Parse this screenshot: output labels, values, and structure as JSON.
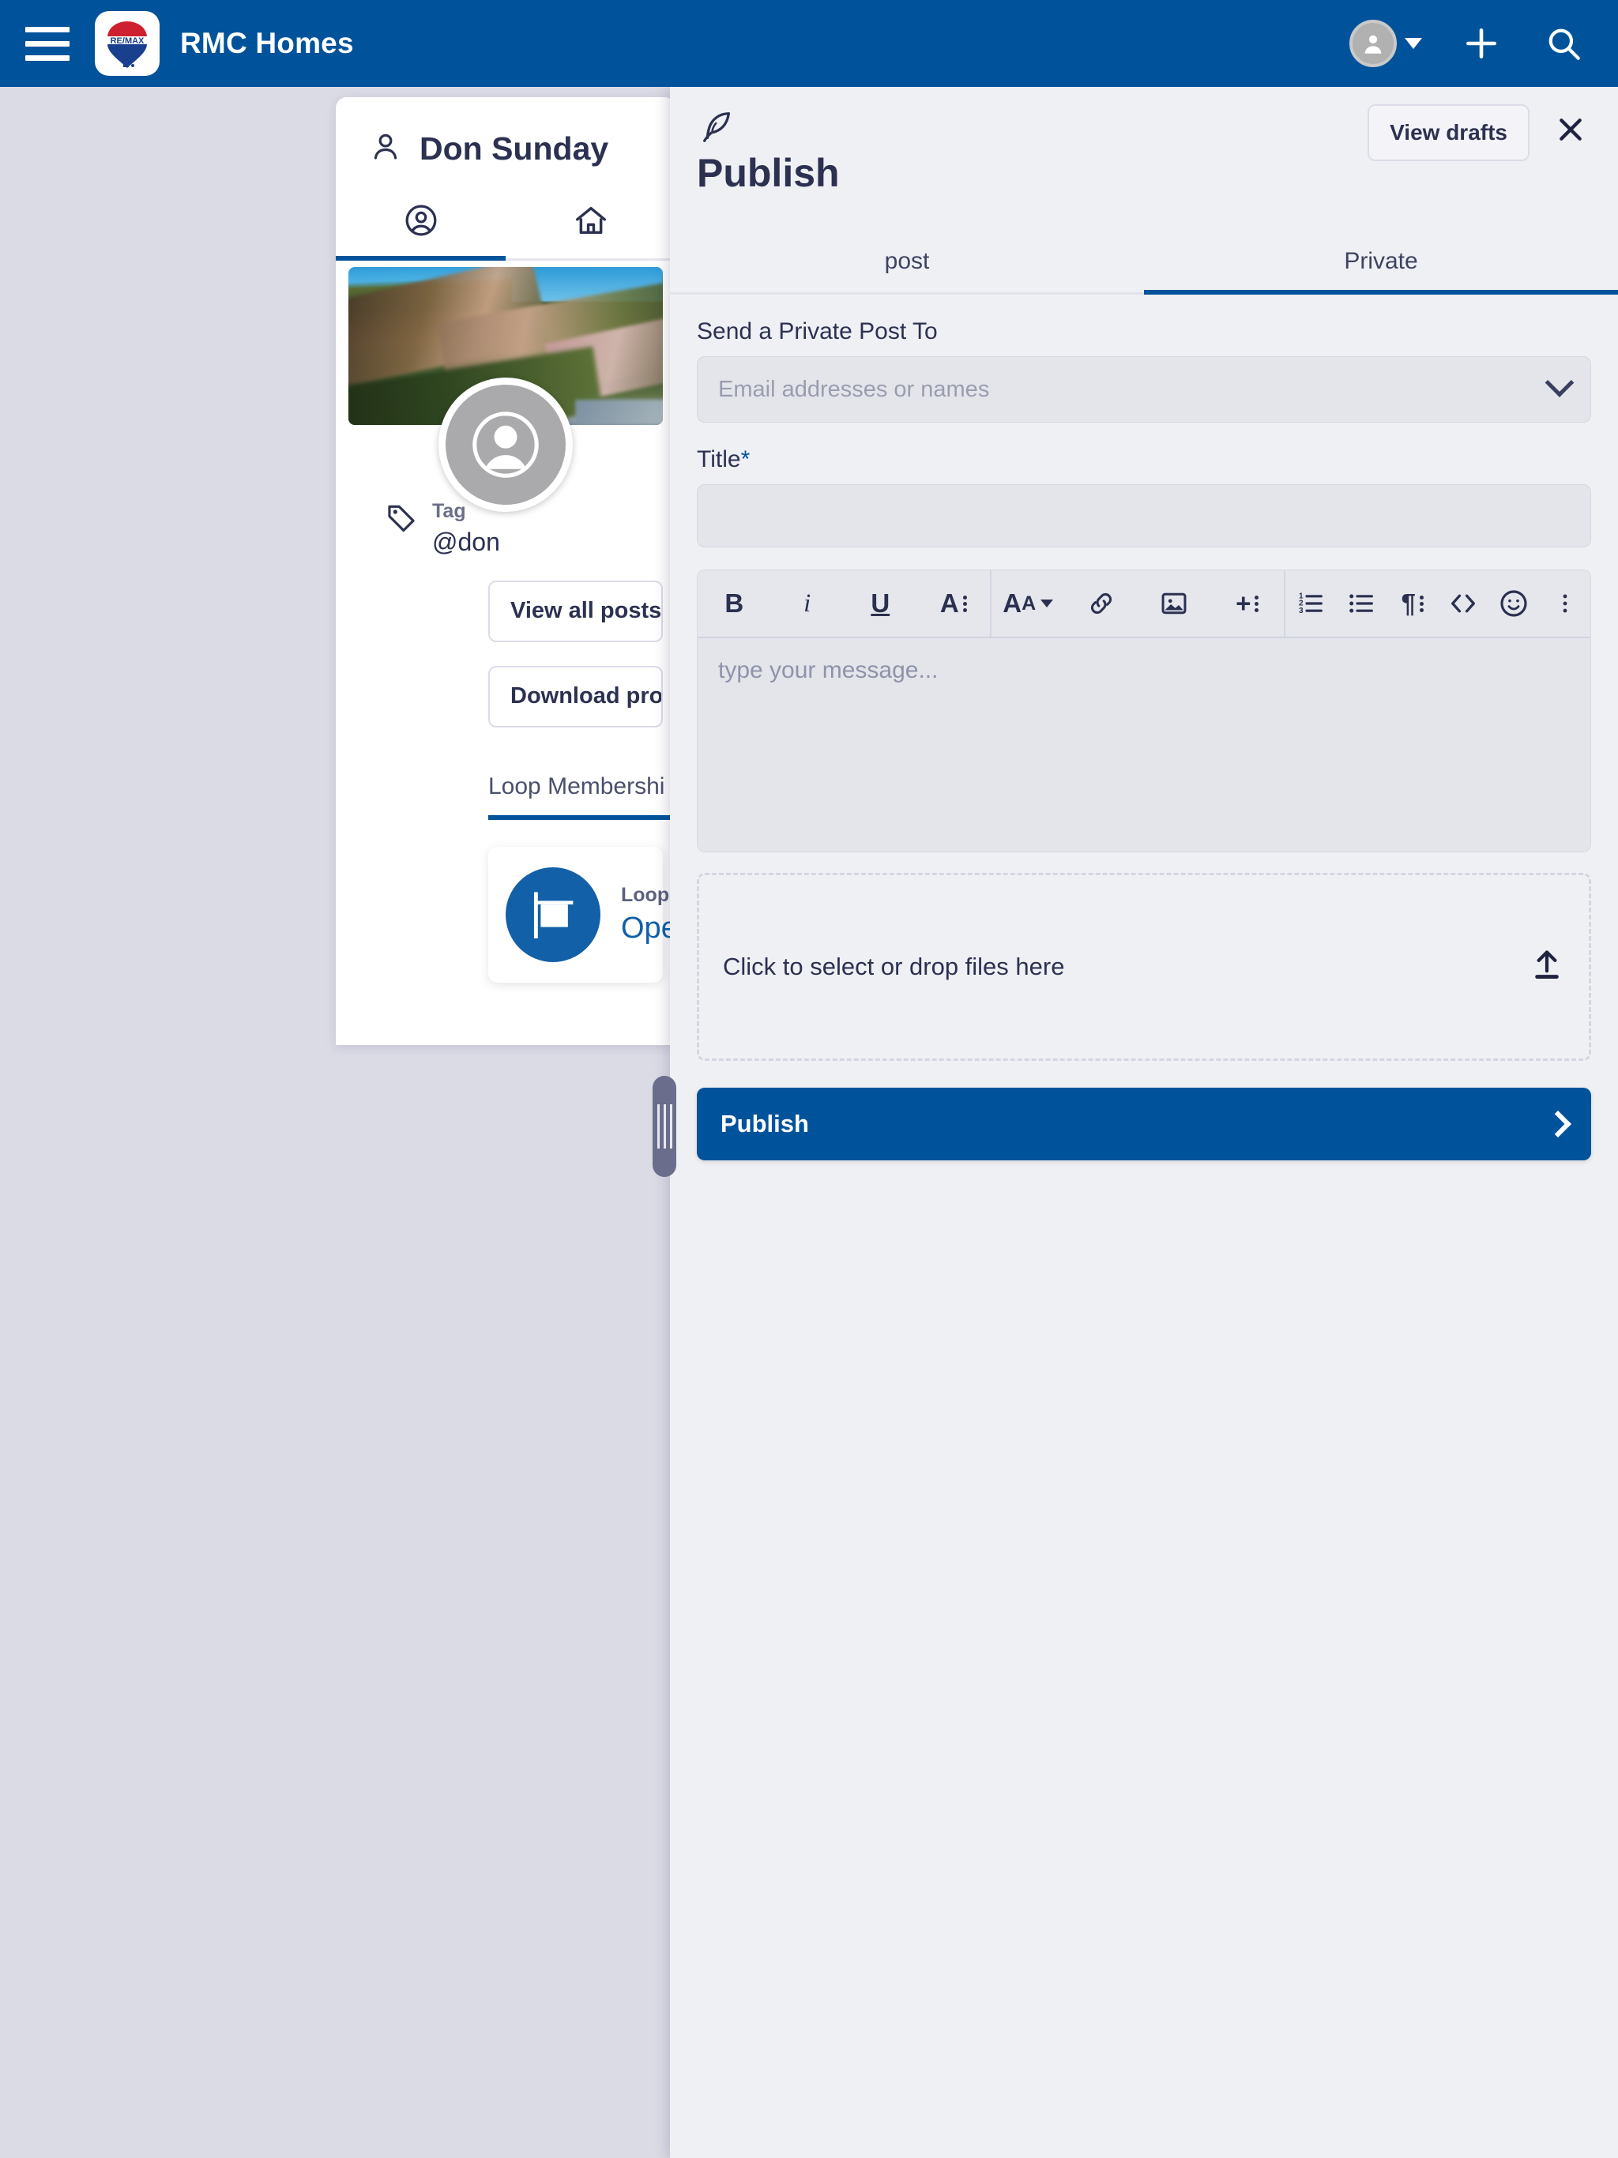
{
  "appbar": {
    "menu_icon": "hamburger-menu-icon",
    "logo_icon": "remax-balloon-logo",
    "title": "RMC Homes",
    "avatar_icon": "user-avatar-icon",
    "caret_icon": "chevron-down-icon",
    "add_icon": "plus-icon",
    "search_icon": "search-icon",
    "bg_color": "#00539b"
  },
  "profile": {
    "person_icon": "person-outline-icon",
    "name": "Don Sunday",
    "tabs": [
      {
        "icon": "person-circle-icon",
        "name": "profile",
        "active": true
      },
      {
        "icon": "home-icon",
        "name": "home",
        "active": false
      }
    ],
    "cover_photo_alt": "coastal cliff cover photo",
    "avatar_placeholder_icon": "default-user-avatar-icon",
    "tag": {
      "icon": "tag-icon",
      "label": "Tag",
      "value": "@don"
    },
    "buttons": [
      {
        "label": "View all posts an",
        "name": "view-all-posts-button"
      },
      {
        "label": "Download profile",
        "name": "download-profile-button"
      }
    ],
    "loop_tab": "Loop Membershi",
    "loop_card": {
      "icon": "realestate-sign-icon",
      "label": "Loop",
      "value": "Ope"
    }
  },
  "publish": {
    "feather_icon": "feather-quill-icon",
    "view_drafts_label": "View drafts",
    "close_icon": "close-x-icon",
    "title": "Publish",
    "tabs": [
      {
        "label": "post",
        "active": false
      },
      {
        "label": "Private",
        "active": true
      }
    ],
    "recipients": {
      "label": "Send a Private Post To",
      "placeholder": "Email addresses or names",
      "value": "",
      "chevron_icon": "chevron-down-icon"
    },
    "title_field": {
      "label": "Title",
      "required_mark": "*",
      "placeholder": "",
      "value": ""
    },
    "toolbar": [
      {
        "glyph": "B",
        "name": "bold-icon"
      },
      {
        "glyph": "i",
        "name": "italic-icon"
      },
      {
        "glyph": "U",
        "name": "underline-icon"
      },
      {
        "glyph": "A",
        "name": "text-color-icon"
      },
      {
        "glyph": "AA",
        "name": "font-size-icon"
      },
      {
        "glyph": "link",
        "name": "link-icon"
      },
      {
        "glyph": "image",
        "name": "image-icon"
      },
      {
        "glyph": "+",
        "name": "insert-icon"
      },
      {
        "glyph": "ol",
        "name": "numbered-list-icon"
      },
      {
        "glyph": "ul",
        "name": "bullet-list-icon"
      },
      {
        "glyph": "para",
        "name": "paragraph-format-icon"
      },
      {
        "glyph": "code",
        "name": "code-icon"
      },
      {
        "glyph": "emoji",
        "name": "emoji-icon"
      },
      {
        "glyph": "more",
        "name": "more-options-icon"
      }
    ],
    "editor_placeholder": "type your message...",
    "dropzone": {
      "text": "Click to select or drop files here",
      "icon": "upload-icon"
    },
    "publish_button": {
      "label": "Publish",
      "chevron_icon": "chevron-right-icon",
      "color": "#00539b"
    }
  },
  "resize_grip": {
    "name": "panel-resize-handle"
  }
}
